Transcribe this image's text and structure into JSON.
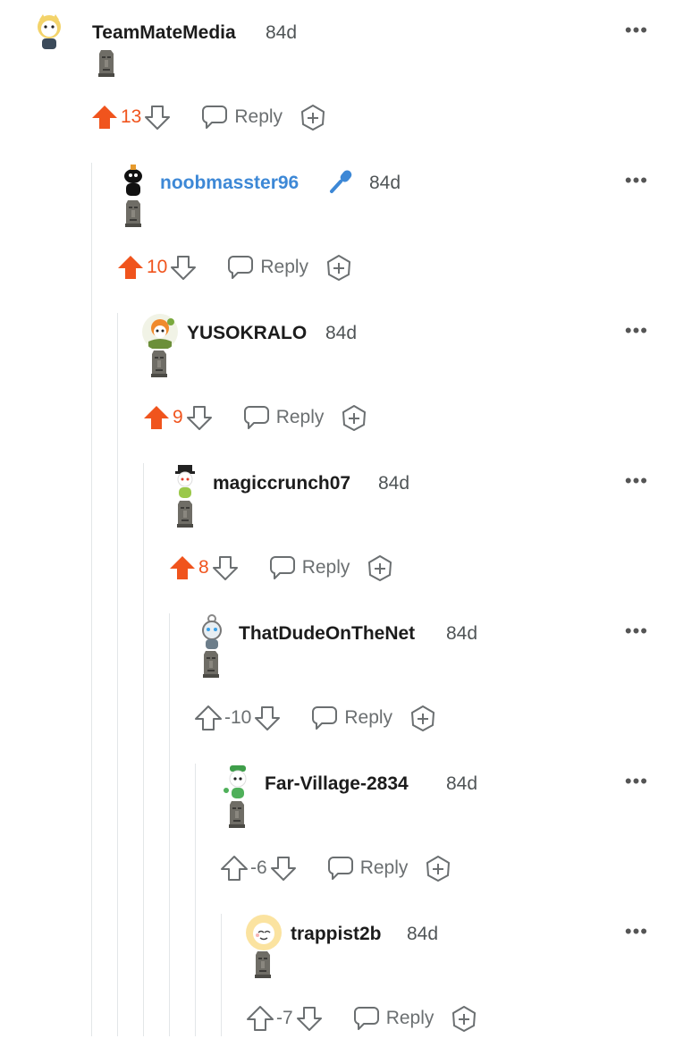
{
  "thread": {
    "reply_label": "Reply",
    "more_label": "•••",
    "comments": [
      {
        "username": "TeamMateMedia",
        "age": "84d",
        "score": "13",
        "voted": "up",
        "body_icon": "moai-emoji"
      },
      {
        "username": "noobmasster96",
        "age": "84d",
        "score": "10",
        "voted": "up",
        "body_icon": "moai-emoji",
        "flair_icon": "microphone-icon"
      },
      {
        "username": "YUSOKRALO",
        "age": "84d",
        "score": "9",
        "voted": "up",
        "body_icon": "moai-emoji"
      },
      {
        "username": "magiccrunch07",
        "age": "84d",
        "score": "8",
        "voted": "up",
        "body_icon": "moai-emoji"
      },
      {
        "username": "ThatDudeOnTheNet",
        "age": "84d",
        "score": "-10",
        "voted": "none",
        "body_icon": "moai-emoji"
      },
      {
        "username": "Far-Village-2834",
        "age": "84d",
        "score": "-6",
        "voted": "none",
        "body_icon": "moai-emoji"
      },
      {
        "username": "trappist2b",
        "age": "84d",
        "score": "-7",
        "voted": "none",
        "body_icon": "moai-emoji"
      }
    ]
  },
  "colors": {
    "upvote": "#f0541d",
    "username_highlight": "#3d88d6",
    "text": "#1c1c1c",
    "muted": "#6b6f71",
    "thread_line": "#e3e6e8"
  }
}
